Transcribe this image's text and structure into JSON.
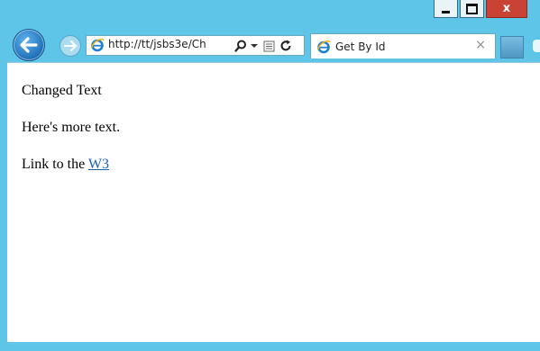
{
  "window": {
    "minimize_glyph": "minimize-icon",
    "maximize_glyph": "maximize-icon",
    "close_label": "x"
  },
  "toolbar": {
    "back_icon": "back-arrow-icon",
    "forward_icon": "forward-arrow-icon",
    "address_url": "http://tt/jsbs3e/Ch",
    "search_icon": "search-icon",
    "dropdown_icon": "dropdown-caret-icon",
    "compat_icon": "compatibility-view-icon",
    "refresh_icon": "refresh-icon"
  },
  "tab": {
    "title": "Get By Id",
    "close_label": "×"
  },
  "page": {
    "paragraph1": "Changed Text",
    "paragraph2": "Here's more text.",
    "link_prefix": "Link to the ",
    "link_text": "W3"
  },
  "colors": {
    "frame": "#5fc5e8",
    "close_button": "#c94234",
    "link": "#1a5fb4"
  }
}
